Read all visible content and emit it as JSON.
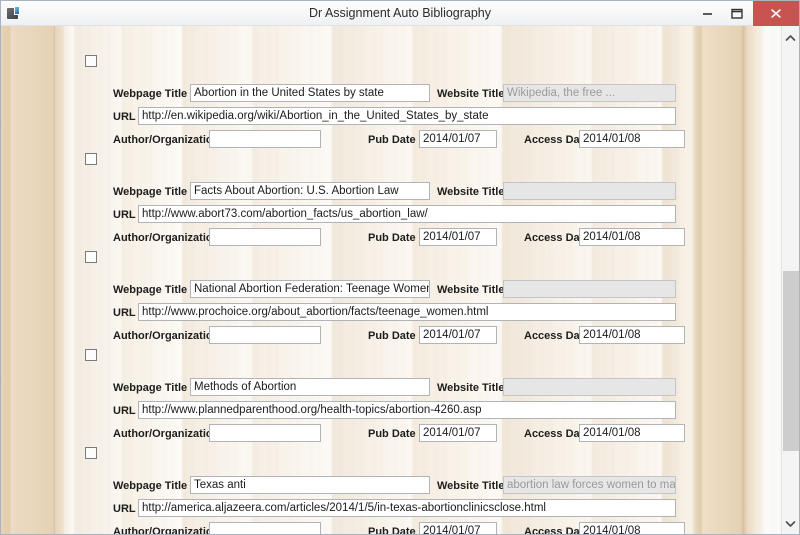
{
  "window": {
    "title": "Dr Assignment Auto Bibliography",
    "icon": "app-icon",
    "controls": {
      "minimize": "minimize-icon",
      "maximize": "maximize-icon",
      "close": "close-icon"
    },
    "close_color": "#c75450"
  },
  "labels": {
    "webpage_title": "Webpage Title",
    "website_title": "Website Title",
    "url": "URL",
    "author": "Author/Organization",
    "pub_date": "Pub Date",
    "access_date": "Access Date"
  },
  "scrollbar": {
    "up_icon": "chevron-up-icon",
    "down_icon": "chevron-down-icon",
    "thumb": "scroll-thumb"
  },
  "entries": [
    {
      "checked": false,
      "webpage_title": "Abortion in the United States by state",
      "website_title": "Wikipedia, the free ...",
      "website_title_disabled": true,
      "url": "http://en.wikipedia.org/wiki/Abortion_in_the_United_States_by_state",
      "author": "",
      "pub_date": "2014/01/07",
      "access_date": "2014/01/08"
    },
    {
      "checked": false,
      "webpage_title": "Facts About Abortion: U.S. Abortion Law",
      "website_title": "",
      "website_title_disabled": true,
      "url": "http://www.abort73.com/abortion_facts/us_abortion_law/",
      "author": "",
      "pub_date": "2014/01/07",
      "access_date": "2014/01/08"
    },
    {
      "checked": false,
      "webpage_title": "National Abortion Federation: Teenage Women, Ab",
      "website_title": "",
      "website_title_disabled": true,
      "url": "http://www.prochoice.org/about_abortion/facts/teenage_women.html",
      "author": "",
      "pub_date": "2014/01/07",
      "access_date": "2014/01/08"
    },
    {
      "checked": false,
      "webpage_title": "Methods of Abortion",
      "website_title": "",
      "website_title_disabled": true,
      "url": "http://www.plannedparenthood.org/health-topics/abortion-4260.asp",
      "author": "",
      "pub_date": "2014/01/07",
      "access_date": "2014/01/08"
    },
    {
      "checked": false,
      "webpage_title": "Texas anti",
      "website_title": "abortion law forces women to make",
      "website_title_disabled": true,
      "url": "http://america.aljazeera.com/articles/2014/1/5/in-texas-abortionclinicsclose.html",
      "author": "",
      "pub_date": "2014/01/07",
      "access_date": "2014/01/08"
    }
  ]
}
